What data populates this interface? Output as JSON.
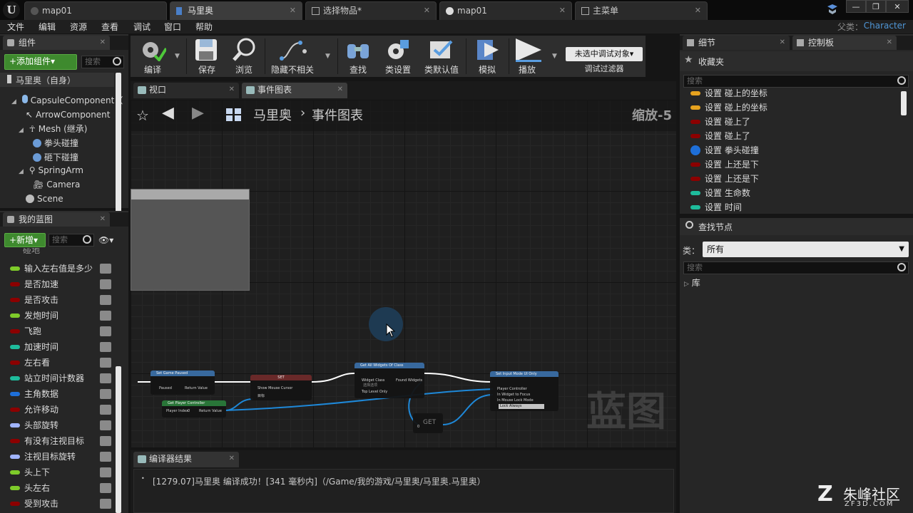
{
  "tabs": [
    {
      "label": "map01",
      "icon": "ue-icon"
    },
    {
      "label": "马里奥",
      "icon": "blueprint-icon"
    },
    {
      "label": "选择物品*",
      "icon": "widget-icon"
    },
    {
      "label": "map01",
      "icon": "level-icon"
    },
    {
      "label": "主菜单",
      "icon": "widget-icon"
    }
  ],
  "menu": [
    "文件",
    "编辑",
    "资源",
    "查看",
    "调试",
    "窗口",
    "帮助"
  ],
  "parent": {
    "label": "父类：",
    "value": "Character"
  },
  "components": {
    "title": "组件",
    "add_label": "+添加组件▾",
    "search_placeholder": "搜索",
    "items": [
      {
        "label": "马里奥（自身）"
      },
      {
        "label": "CapsuleComponent（"
      },
      {
        "label": "ArrowComponent（"
      },
      {
        "label": "Mesh (继承)"
      },
      {
        "label": "拳头碰撞"
      },
      {
        "label": "砸下碰撞"
      },
      {
        "label": "SpringArm"
      },
      {
        "label": "Camera"
      },
      {
        "label": "Scene"
      }
    ]
  },
  "my_blueprint": {
    "title": "我的蓝图",
    "new_label": "+新增▾",
    "search_placeholder": "搜索",
    "cut_row": "碰地",
    "variables": [
      {
        "label": "输入左右值是多少",
        "color": "#7ecb2a"
      },
      {
        "label": "是否加速",
        "color": "#8c0000"
      },
      {
        "label": "是否攻击",
        "color": "#8c0000"
      },
      {
        "label": "发炮时间",
        "color": "#7ecb2a"
      },
      {
        "label": "飞跑",
        "color": "#8c0000"
      },
      {
        "label": "加速时间",
        "color": "#1ebc9c"
      },
      {
        "label": "左右看",
        "color": "#8c0000"
      },
      {
        "label": "站立时间计数器",
        "color": "#1ebc9c"
      },
      {
        "label": "主角数据",
        "color": "#1e6fd8"
      },
      {
        "label": "允许移动",
        "color": "#8c0000"
      },
      {
        "label": "头部旋转",
        "color": "#a0b4ff"
      },
      {
        "label": "有没有注视目标",
        "color": "#8c0000"
      },
      {
        "label": "注视目标旋转",
        "color": "#a0b4ff"
      },
      {
        "label": "头上下",
        "color": "#7ecb2a"
      },
      {
        "label": "头左右",
        "color": "#7ecb2a"
      },
      {
        "label": "受到攻击",
        "color": "#8c0000"
      }
    ]
  },
  "toolbar": {
    "buttons": [
      "编译",
      "保存",
      "浏览",
      "隐藏不相关",
      "查找",
      "类设置",
      "类默认值",
      "模拟",
      "播放"
    ],
    "debug_select": "未选中调试对象▾",
    "debug_filter": "调试过滤器"
  },
  "editor_tabs": [
    "视口",
    "事件图表"
  ],
  "graph": {
    "breadcrumb_root": "马里奥",
    "breadcrumb_sep": "›",
    "breadcrumb_leaf": "事件图表",
    "zoom": "缩放-5",
    "watermark": "蓝图",
    "nodes": {
      "set_game_paused": {
        "title": "Set Game Paused",
        "in": "Paused",
        "out": "Return Value"
      },
      "set": {
        "title": "SET",
        "in": "Show Mouse Cursor",
        "target": "目标"
      },
      "get_player_controller": {
        "title": "Get Player Controller",
        "in": "Player Index",
        "index": "0",
        "out": "Return Value"
      },
      "get_all_widgets": {
        "title": "Get All Widgets Of Class",
        "in1": "Widget Class",
        "in1_val": "选择选项",
        "in2": "Top Level Only",
        "out": "Found Widgets"
      },
      "set_input_mode": {
        "title": "Set Input Mode UI Only",
        "in1": "Player Controller",
        "in2": "In Widget to Focus",
        "in3": "In Mouse Lock Mode",
        "mode": "Lock Always"
      },
      "get": {
        "title": "GET",
        "index": "0"
      }
    }
  },
  "details": {
    "tab1": "细节",
    "tab2": "控制板"
  },
  "favorites": {
    "title": "收藏夹",
    "search_placeholder": "搜索",
    "items": [
      {
        "label": "设置 碰上的坐标",
        "color": "#e6a21e"
      },
      {
        "label": "设置 碰上的坐标",
        "color": "#e6a21e"
      },
      {
        "label": "设置 碰上了",
        "color": "#8c0000"
      },
      {
        "label": "设置 碰上了",
        "color": "#8c0000"
      },
      {
        "label": "设置 拳头碰撞",
        "color": "#1e6fd8"
      },
      {
        "label": "设置 上还是下",
        "color": "#8c0000"
      },
      {
        "label": "设置 上还是下",
        "color": "#8c0000"
      },
      {
        "label": "设置 生命数",
        "color": "#1ebc9c"
      },
      {
        "label": "设置 时间",
        "color": "#1ebc9c"
      }
    ]
  },
  "find_node": {
    "title": "查找节点",
    "class_label": "类：",
    "class_value": "所有",
    "search_placeholder": "搜索",
    "library": "库"
  },
  "compiler": {
    "title": "编译器结果",
    "message": "[1279.07]马里奥 编译成功！[341 毫秒内]（/Game/我的游戏/马里奥/马里奥.马里奥）"
  },
  "watermark_site": {
    "name": "朱峰社区",
    "url": "ZF3D.COM"
  }
}
